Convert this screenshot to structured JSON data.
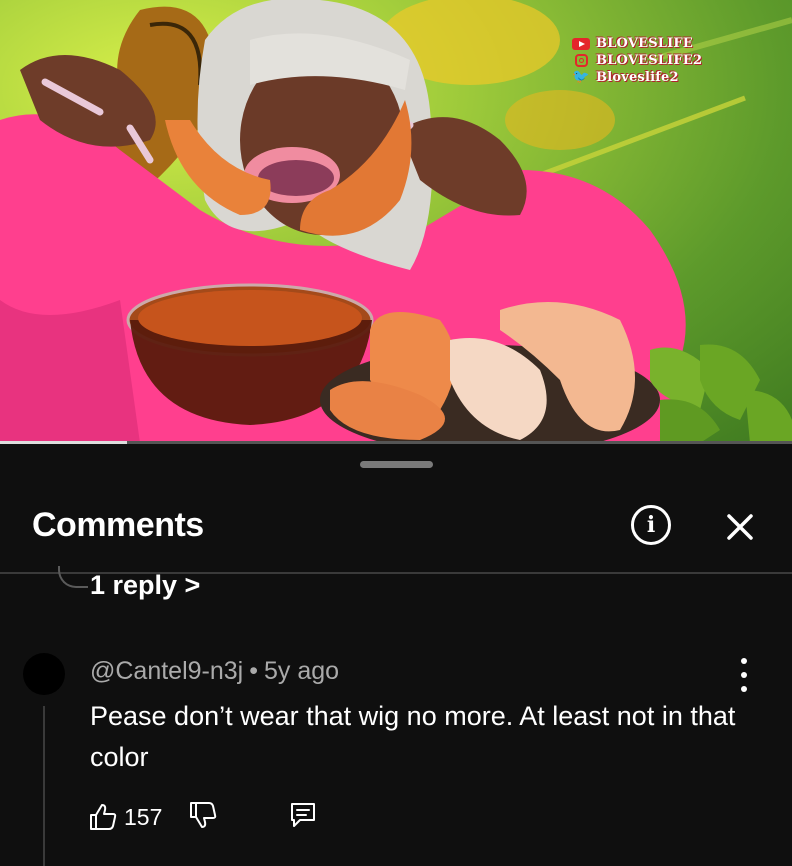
{
  "video": {
    "watermark": {
      "youtube": "BLOVESLIFE",
      "instagram": "BLOVESLIFE2",
      "twitter": "Bloveslife2"
    },
    "progress_fraction": 0.16
  },
  "comments_panel": {
    "title": "Comments",
    "info_icon": "info-icon",
    "close_icon": "close-icon",
    "reply_link": "1 reply >",
    "comment": {
      "author": "@Cantel9-n3j",
      "separator": "•",
      "age": "5y ago",
      "text": "Pease don’t wear that wig no more. At least not in that color",
      "likes": "157",
      "icons": [
        "thumbs-up-icon",
        "thumbs-down-icon",
        "reply-icon",
        "more-vert-icon"
      ]
    }
  },
  "colors": {
    "background": "#0f0f0f",
    "text": "#f1f1f1",
    "secondary_text": "#aaaaaa",
    "accent_pink": "#ff3f8e"
  }
}
